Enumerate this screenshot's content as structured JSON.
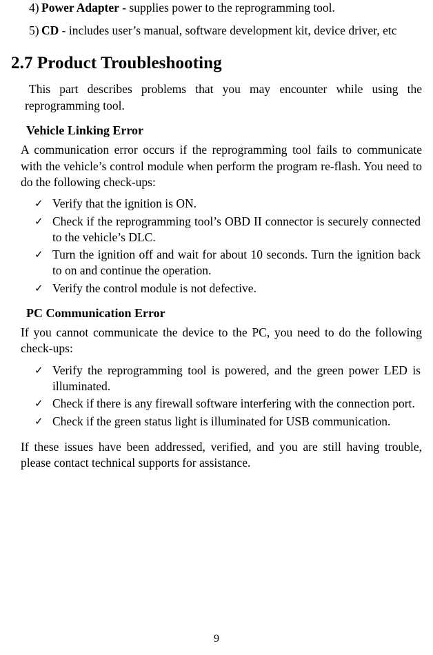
{
  "numbered_items": [
    {
      "marker": "4)",
      "bold": "Power Adapter",
      "rest": " - supplies power to the reprogramming tool."
    },
    {
      "marker": "5)",
      "bold": "CD",
      "rest": " - includes user’s manual, software development kit, device driver, etc"
    }
  ],
  "section": {
    "heading": "2.7 Product Troubleshooting",
    "intro": "This part describes problems that you may encounter while using the reprogramming tool."
  },
  "vehicle_linking": {
    "heading": "Vehicle Linking Error",
    "body": "A communication error occurs if the reprogramming tool fails to communicate with the vehicle’s control module when perform the program re-flash. You need to do the following check-ups:",
    "checks": [
      "Verify that the ignition is ON.",
      "Check if the reprogramming tool’s OBD II connector is securely connected to the vehicle’s DLC.",
      "Turn the ignition off and wait for about 10 seconds. Turn the ignition back to on and continue the operation.",
      "Verify the control module is not defective."
    ]
  },
  "pc_communication": {
    "heading": "PC Communication Error",
    "body": "If you cannot communicate the device to the PC, you need to do the following check-ups:",
    "checks": [
      "Verify the reprogramming tool is powered, and the green power LED is illuminated.",
      "Check if there is any firewall software interfering with the connection port.",
      "Check if the green status light is illuminated for USB communication."
    ]
  },
  "closing": "If these issues have been addressed, verified, and you are still having trouble, please contact technical supports for assistance.",
  "icons": {
    "check_mark": "✓"
  },
  "footer": {
    "page_number": "9"
  }
}
